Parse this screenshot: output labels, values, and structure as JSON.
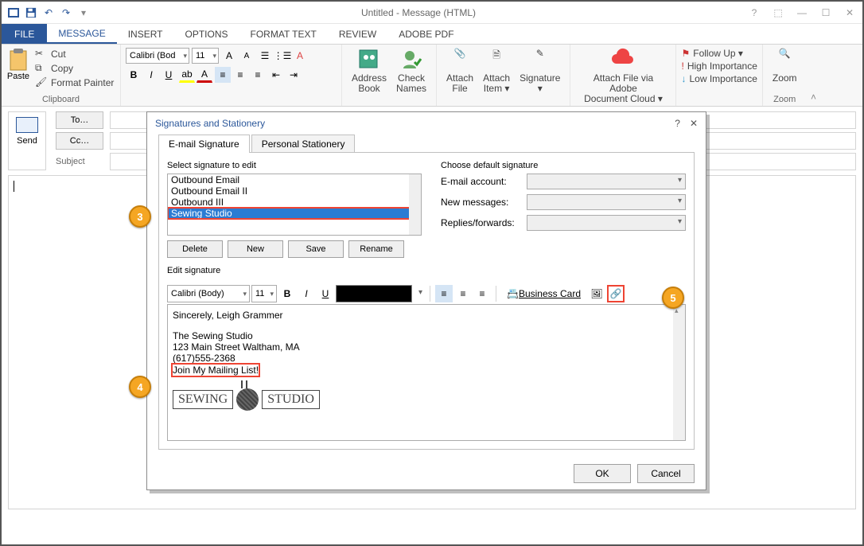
{
  "titlebar": {
    "title": "Untitled - Message (HTML)"
  },
  "tabs": {
    "file": "FILE",
    "message": "MESSAGE",
    "insert": "INSERT",
    "options": "OPTIONS",
    "format_text": "FORMAT TEXT",
    "review": "REVIEW",
    "adobe_pdf": "ADOBE PDF"
  },
  "clipboard": {
    "paste": "Paste",
    "cut": "Cut",
    "copy": "Copy",
    "format_painter": "Format Painter",
    "label": "Clipboard"
  },
  "basic_text": {
    "font": "Calibri (Bod",
    "size": "11",
    "labels": {
      "A_up": "A",
      "A_dn": "A"
    }
  },
  "names_group": {
    "address": "Address\nBook",
    "check": "Check\nNames"
  },
  "include": {
    "attach_file": "Attach\nFile",
    "attach_item": "Attach\nItem ▾",
    "signature": "Signature\n▾"
  },
  "adobe": {
    "attach_cloud": "Attach File via Adobe\nDocument Cloud ▾"
  },
  "tags": {
    "followup": "Follow Up ▾",
    "hi": "High Importance",
    "lo": "Low Importance"
  },
  "zoom": {
    "zoom": "Zoom",
    "label": "Zoom"
  },
  "compose": {
    "send": "Send",
    "to": "To…",
    "cc": "Cc…",
    "subject": "Subject"
  },
  "dialog": {
    "title": "Signatures and Stationery",
    "tab_email": "E-mail Signature",
    "tab_personal": "Personal Stationery",
    "select_label": "Select signature to edit",
    "list": [
      "Outbound Email",
      "Outbound Email II",
      "Outbound III",
      "Sewing Studio"
    ],
    "buttons": {
      "delete": "Delete",
      "new": "New",
      "save": "Save",
      "rename": "Rename"
    },
    "default_label": "Choose default signature",
    "defaults": {
      "account": "E-mail account:",
      "new": "New messages:",
      "replies": "Replies/forwards:"
    },
    "edit_label": "Edit signature",
    "toolbar": {
      "font": "Calibri (Body)",
      "size": "11",
      "bizcard": "Business Card"
    },
    "editor": {
      "line1": "Sincerely,   Leigh Grammer",
      "line2": "The Sewing Studio",
      "line3": "123 Main Street Waltham, MA",
      "line4": "(617)555-2368",
      "link": "Join My Mailing List!",
      "logo_left": "SEWING",
      "logo_right": "STUDIO"
    },
    "footer": {
      "ok": "OK",
      "cancel": "Cancel"
    }
  },
  "annot": {
    "3": "3",
    "4": "4",
    "5": "5"
  }
}
